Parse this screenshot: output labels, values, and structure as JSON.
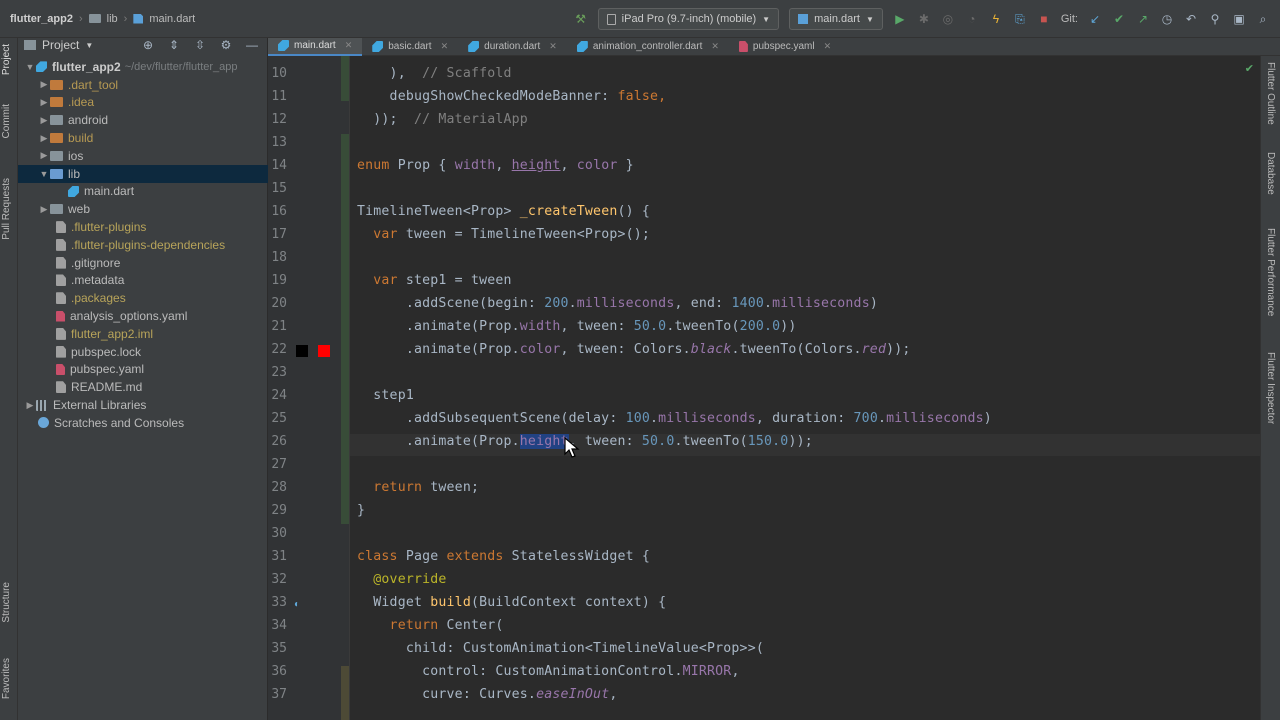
{
  "titlebar": {
    "project": "flutter_app2",
    "folder": "lib",
    "file": "main.dart",
    "device": "iPad Pro (9.7-inch) (mobile)",
    "run_config": "main.dart",
    "git_label": "Git:"
  },
  "left_strip": {
    "project_tab": "Project",
    "commit_tab": "Commit",
    "pull_requests_tab": "Pull Requests",
    "structure_tab": "Structure",
    "favorites_tab": "Favorites"
  },
  "project_panel": {
    "title": "Project",
    "root_name": "flutter_app2",
    "root_path": "~/dev/flutter/flutter_app",
    "items": [
      {
        "label": ".dart_tool"
      },
      {
        "label": ".idea"
      },
      {
        "label": "android"
      },
      {
        "label": "build"
      },
      {
        "label": "ios"
      },
      {
        "label": "lib"
      },
      {
        "label": "main.dart"
      },
      {
        "label": "web"
      },
      {
        "label": ".flutter-plugins"
      },
      {
        "label": ".flutter-plugins-dependencies"
      },
      {
        "label": ".gitignore"
      },
      {
        "label": ".metadata"
      },
      {
        "label": ".packages"
      },
      {
        "label": "analysis_options.yaml"
      },
      {
        "label": "flutter_app2.iml"
      },
      {
        "label": "pubspec.lock"
      },
      {
        "label": "pubspec.yaml"
      },
      {
        "label": "README.md"
      },
      {
        "label": "External Libraries"
      },
      {
        "label": "Scratches and Consoles"
      }
    ]
  },
  "tabs": [
    {
      "label": "main.dart"
    },
    {
      "label": "basic.dart"
    },
    {
      "label": "duration.dart"
    },
    {
      "label": "animation_controller.dart"
    },
    {
      "label": "pubspec.yaml"
    }
  ],
  "right_strip": {
    "flutter_outline": "Flutter Outline",
    "database": "Database",
    "flutter_performance": "Flutter Performance",
    "flutter_inspector": "Flutter Inspector"
  },
  "editor": {
    "line_numbers": [
      "10",
      "11",
      "12",
      "13",
      "14",
      "15",
      "16",
      "17",
      "18",
      "19",
      "20",
      "21",
      "22",
      "23",
      "24",
      "25",
      "26",
      "27",
      "28",
      "29",
      "30",
      "31",
      "32",
      "33",
      "34",
      "35",
      "36",
      "37"
    ],
    "lines": {
      "l10_a": "    ),  ",
      "l10_b": "// Scaffold",
      "l11_a": "    debugShowCheckedModeBanner: ",
      "l11_b": "false",
      "l11_c": ",",
      "l12_a": "  ));  ",
      "l12_b": "// MaterialApp",
      "l14_kw": "enum ",
      "l14_a": "Prop { ",
      "l14_w": "width",
      "l14_s1": ", ",
      "l14_h": "height",
      "l14_s2": ", ",
      "l14_c": "color",
      "l14_e": " }",
      "l16_a": "TimelineTween<Prop> ",
      "l16_fn": "_createTween",
      "l16_b": "() {",
      "l17_kw": "  var ",
      "l17_a": "tween = TimelineTween<Prop>();",
      "l19_kw": "  var ",
      "l19_a": "step1 = tween",
      "l20_a": "      .addScene(begin: ",
      "l20_n1": "200",
      "l20_b": ".",
      "l20_m1": "milliseconds",
      "l20_c": ", end: ",
      "l20_n2": "1400",
      "l20_d": ".",
      "l20_m2": "milliseconds",
      "l20_e": ")",
      "l21_a": "      .animate(Prop.",
      "l21_w": "width",
      "l21_b": ", tween: ",
      "l21_n1": "50.0",
      "l21_c": ".tweenTo(",
      "l21_n2": "200.0",
      "l21_d": "))",
      "l22_a": "      .animate(Prop.",
      "l22_c": "color",
      "l22_b": ", tween: Colors.",
      "l22_blk": "black",
      "l22_d": ".tweenTo(Colors.",
      "l22_red": "red",
      "l22_e": "));",
      "l24_a": "  step1",
      "l25_a": "      .addSubsequentScene(delay: ",
      "l25_n1": "100",
      "l25_b": ".",
      "l25_m1": "milliseconds",
      "l25_c": ", duration: ",
      "l25_n2": "700",
      "l25_d": ".",
      "l25_m2": "milliseconds",
      "l25_e": ")",
      "l26_a": "      .animate(Prop.",
      "l26_h": "height",
      "l26_b": ", tween: ",
      "l26_n1": "50.0",
      "l26_c": ".tweenTo(",
      "l26_n2": "150.0",
      "l26_d": "));",
      "l28_kw": "  return ",
      "l28_a": "tween;",
      "l29_a": "}",
      "l31_kw1": "class ",
      "l31_a": "Page ",
      "l31_kw2": "extends ",
      "l31_b": "StatelessWidget {",
      "l32_ann": "  @override",
      "l33_a": "  Widget ",
      "l33_fn": "build",
      "l33_b": "(BuildContext context) {",
      "l34_kw": "    return ",
      "l34_a": "Center(",
      "l35_a": "      child: CustomAnimation<TimelineValue<Prop>>(",
      "l36_a": "        control: CustomAnimationControl.",
      "l36_en": "MIRROR",
      "l36_b": ",",
      "l37_a": "        curve: Curves.",
      "l37_en": "easeInOut",
      "l37_b": ","
    }
  },
  "colors": {
    "keyword": "#cc7832",
    "enum_member": "#9876aa",
    "function": "#ffc66d",
    "number": "#6897bb",
    "comment": "#808080",
    "text": "#a9b7c6",
    "selection": "#214283"
  }
}
